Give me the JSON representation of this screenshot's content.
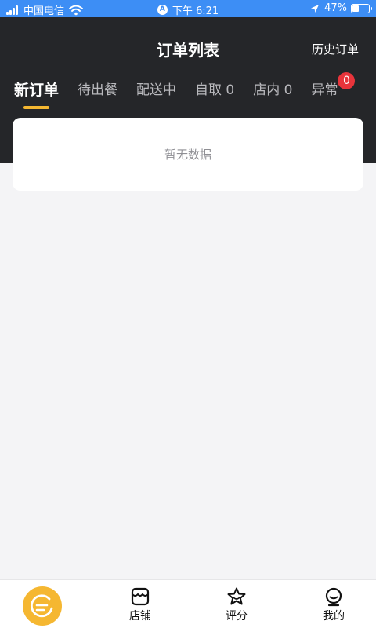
{
  "status_bar": {
    "carrier": "中国电信",
    "time": "下午 6:21",
    "location_badge": "A",
    "battery": "47%",
    "battery_level": 0.47
  },
  "header": {
    "title": "订单列表",
    "history_link": "历史订单"
  },
  "tabs": [
    {
      "label": "新订单",
      "active": true
    },
    {
      "label": "待出餐"
    },
    {
      "label": "配送中"
    },
    {
      "label": "自取 0"
    },
    {
      "label": "店内 0"
    },
    {
      "label": "异常",
      "badge": "0"
    }
  ],
  "content": {
    "empty_text": "暂无数据"
  },
  "tab_bar": {
    "items": [
      {
        "label": "",
        "icon": "brand-logo-icon"
      },
      {
        "label": "店铺",
        "icon": "store-icon"
      },
      {
        "label": "评分",
        "icon": "star-icon"
      },
      {
        "label": "我的",
        "icon": "profile-icon"
      }
    ]
  },
  "colors": {
    "header_bg": "#252629",
    "accent": "#f5b731",
    "badge": "#e8343b",
    "status_bar": "#3d8ef5"
  }
}
